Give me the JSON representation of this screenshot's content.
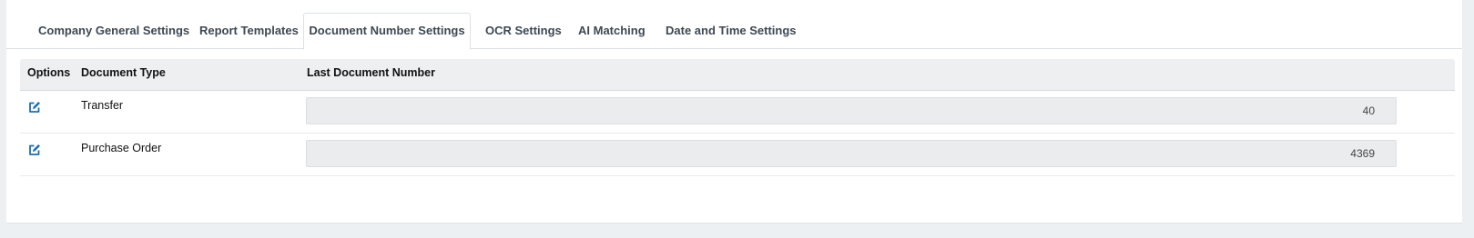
{
  "tabs": [
    {
      "label": "Company General Settings"
    },
    {
      "label": "Report Templates"
    },
    {
      "label": "Document Number Settings",
      "active": true
    },
    {
      "label": "OCR Settings"
    },
    {
      "label": "AI Matching"
    },
    {
      "label": "Date and Time Settings"
    }
  ],
  "table": {
    "headers": {
      "options": "Options",
      "document_type": "Document Type",
      "last_document_number": "Last Document Number"
    },
    "rows": [
      {
        "document_type": "Transfer",
        "last_document_number": "40",
        "icon": "edit-icon"
      },
      {
        "document_type": "Purchase Order",
        "last_document_number": "4369",
        "icon": "edit-icon"
      }
    ]
  },
  "colors": {
    "accent": "#1a6fb5",
    "page_background": "#edf0f2",
    "header_background": "#edeff1",
    "field_background": "#ebeced"
  }
}
